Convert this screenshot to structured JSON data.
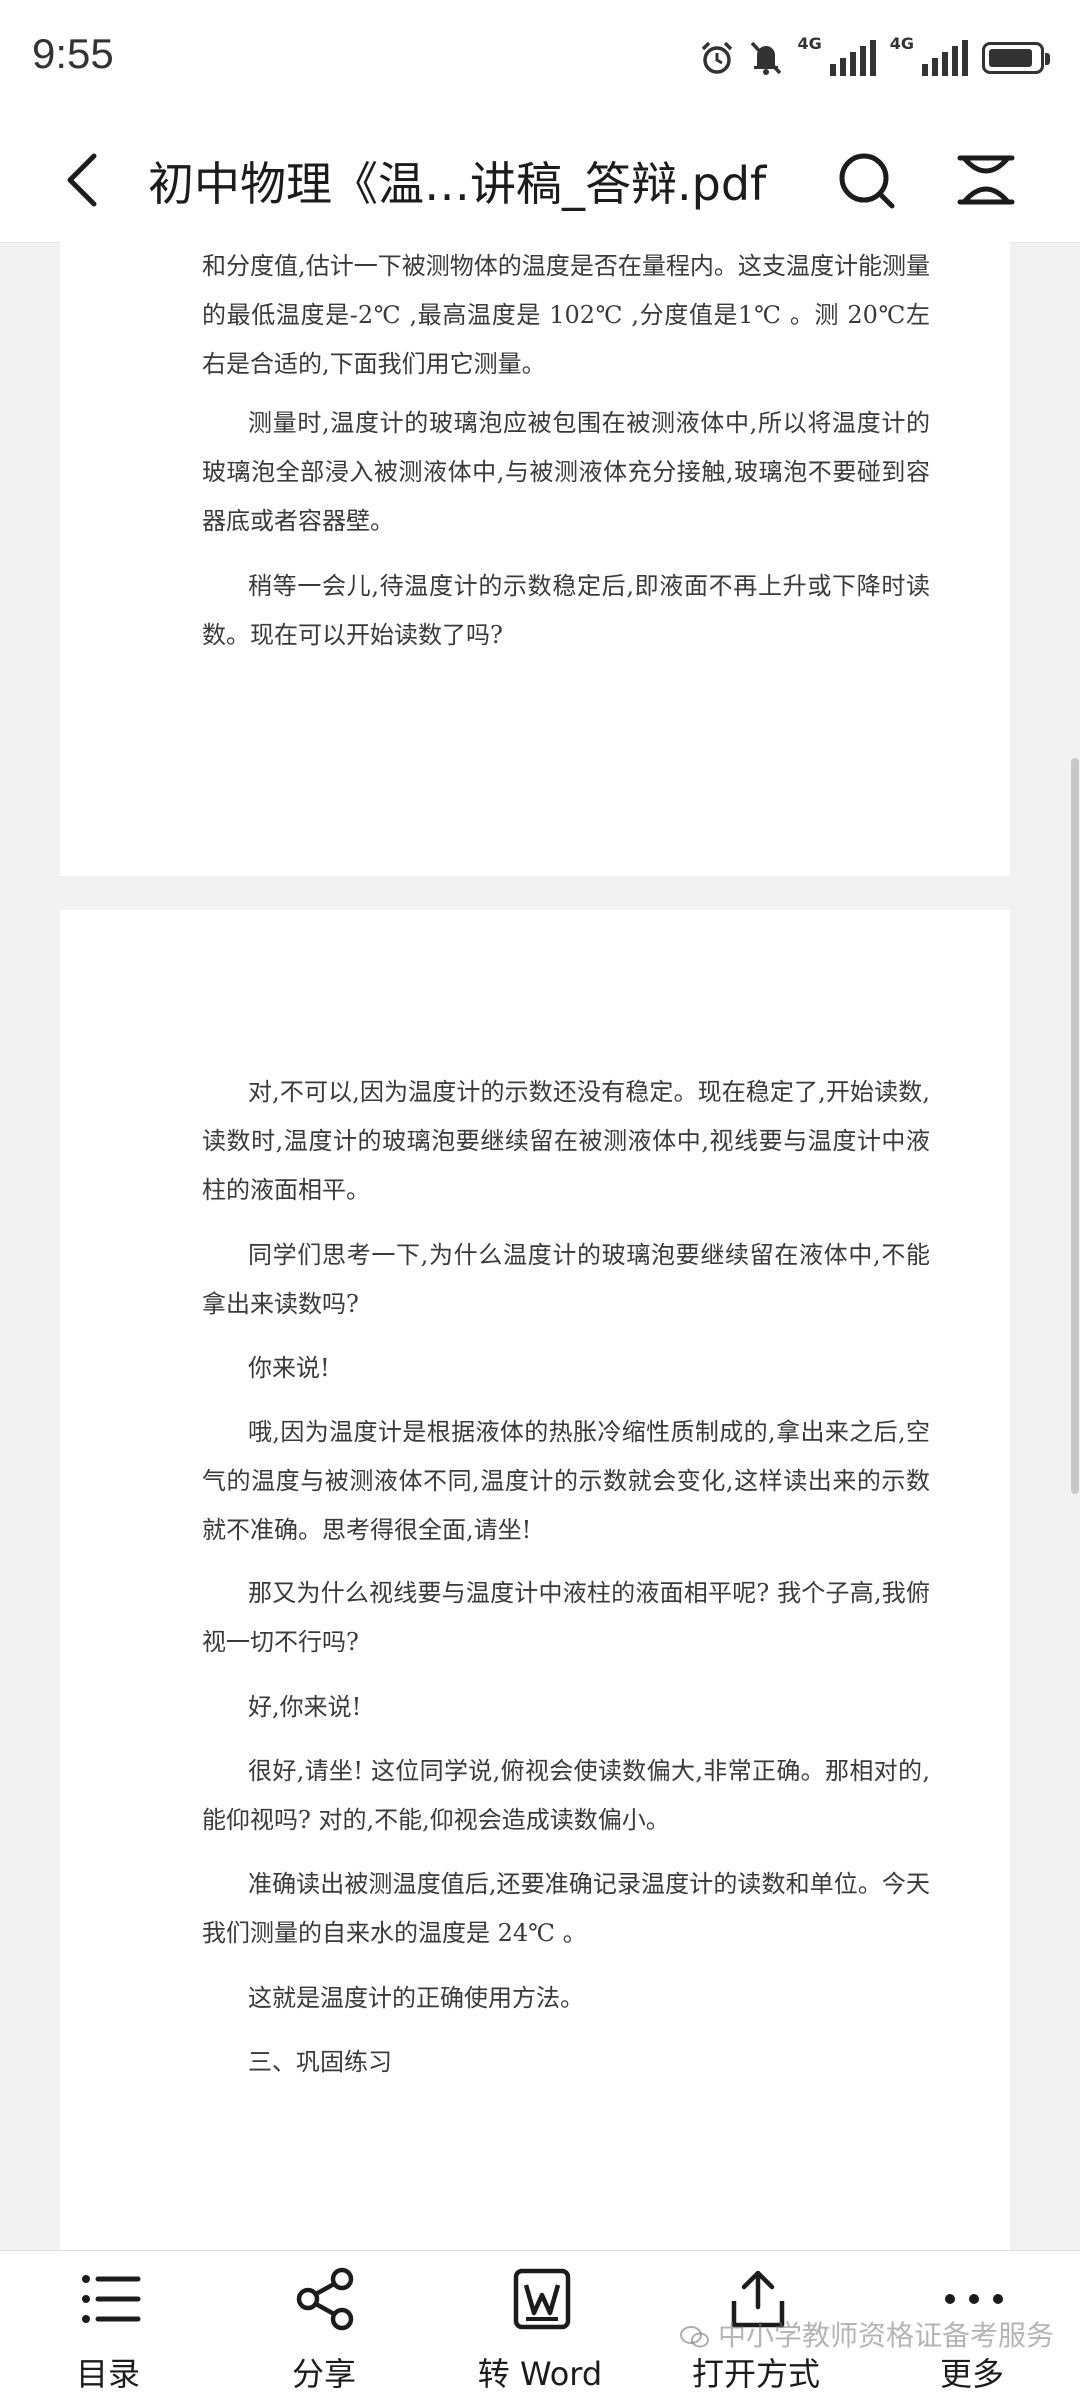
{
  "status_bar": {
    "time": "9:55",
    "network1": "4G",
    "network2": "4G",
    "battery_level": 0.9,
    "icons": [
      "alarm-icon",
      "mute-icon",
      "signal-icon",
      "signal-icon",
      "battery-icon"
    ]
  },
  "title_bar": {
    "title": "初中物理《温…讲稿_答辩.pdf",
    "back_icon": "chevron-left-icon",
    "search_icon": "search-icon",
    "more_icon": "menu-icon"
  },
  "page1": {
    "paragraphs": [
      "和分度值,估计一下被测物体的温度是否在量程内。这支温度计能测量的最低温度是-2℃ ,最高温度是 102℃ ,分度值是1℃ 。测 20℃左右是合适的,下面我们用它测量。",
      "测量时,温度计的玻璃泡应被包围在被测液体中,所以将温度计的玻璃泡全部浸入被测液体中,与被测液体充分接触,玻璃泡不要碰到容器底或者容器壁。",
      "稍等一会儿,待温度计的示数稳定后,即液面不再上升或下降时读数。现在可以开始读数了吗?"
    ]
  },
  "page2": {
    "paragraphs": [
      "对,不可以,因为温度计的示数还没有稳定。现在稳定了,开始读数,读数时,温度计的玻璃泡要继续留在被测液体中,视线要与温度计中液柱的液面相平。",
      "同学们思考一下,为什么温度计的玻璃泡要继续留在液体中,不能拿出来读数吗?",
      "你来说!",
      "哦,因为温度计是根据液体的热胀冷缩性质制成的,拿出来之后,空气的温度与被测液体不同,温度计的示数就会变化,这样读出来的示数就不准确。思考得很全面,请坐!",
      "那又为什么视线要与温度计中液柱的液面相平呢? 我个子高,我俯视一切不行吗?",
      "好,你来说!",
      "很好,请坐! 这位同学说,俯视会使读数偏大,非常正确。那相对的,能仰视吗? 对的,不能,仰视会造成读数偏小。",
      "准确读出被测温度值后,还要准确记录温度计的读数和单位。今天我们测量的自来水的温度是 24℃ 。",
      "这就是温度计的正确使用方法。",
      "三、巩固练习"
    ]
  },
  "bottom_bar": {
    "items": [
      {
        "label": "目录",
        "icon": "list-icon"
      },
      {
        "label": "分享",
        "icon": "share-icon"
      },
      {
        "label": "转 Word",
        "icon": "word-icon"
      },
      {
        "label": "打开方式",
        "icon": "export-icon"
      },
      {
        "label": "更多",
        "icon": "more-icon"
      }
    ],
    "watermark": "中小学教师资格证备考服务"
  }
}
